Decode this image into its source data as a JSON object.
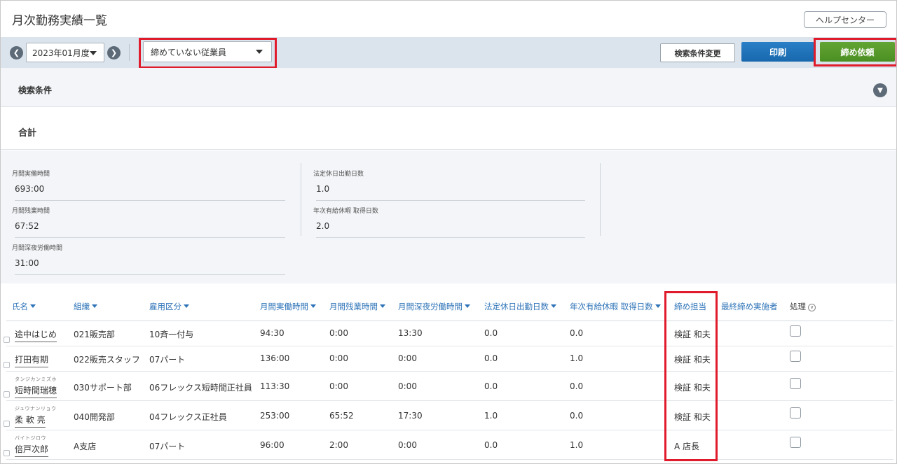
{
  "header": {
    "title": "月次勤務実績一覧",
    "help_label": "ヘルプセンター"
  },
  "toolbar": {
    "month": "2023年01月度",
    "filter": "締めていない従業員",
    "search_change_label": "検索条件変更",
    "print_label": "印刷",
    "close_request_label": "締め依頼"
  },
  "search": {
    "title": "検索条件"
  },
  "totals": {
    "title": "合計",
    "items": [
      {
        "label": "月間実働時間",
        "value": "693:00"
      },
      {
        "label": "月間残業時間",
        "value": "67:52"
      },
      {
        "label": "月間深夜労働時間",
        "value": "31:00"
      },
      {
        "label": "法定休日出勤日数",
        "value": "1.0"
      },
      {
        "label": "年次有給休暇 取得日数",
        "value": "2.0"
      }
    ]
  },
  "table": {
    "columns": [
      "氏名",
      "組織",
      "雇用区分",
      "月間実働時間",
      "月間残業時間",
      "月間深夜労働時間",
      "法定休日出勤日数",
      "年次有給休暇 取得日数",
      "締め担当",
      "最終締め実施者",
      "処理"
    ],
    "rows": [
      {
        "kana": "",
        "name": "途中はじめ",
        "org": "021販売部",
        "type": "10斉一付与",
        "work": "94:30",
        "overtime": "0:00",
        "night": "13:30",
        "holiday": "0.0",
        "paid": "0.0",
        "closer": "検証 和夫",
        "last": ""
      },
      {
        "kana": "",
        "name": "打田有期",
        "org": "022販売スタッフ",
        "type": "07パート",
        "work": "136:00",
        "overtime": "0:00",
        "night": "0:00",
        "holiday": "0.0",
        "paid": "1.0",
        "closer": "検証 和夫",
        "last": ""
      },
      {
        "kana": "タンジカンミズホ",
        "name": "短時間瑞穂",
        "org": "030サポート部",
        "type": "06フレックス短時間正社員",
        "work": "113:30",
        "overtime": "0:00",
        "night": "0:00",
        "holiday": "0.0",
        "paid": "0.0",
        "closer": "検証 和夫",
        "last": ""
      },
      {
        "kana": "ジュウナンリョウ",
        "name": "柔 軟 亮",
        "org": "040開発部",
        "type": "04フレックス正社員",
        "work": "253:00",
        "overtime": "65:52",
        "night": "17:30",
        "holiday": "1.0",
        "paid": "0.0",
        "closer": "検証 和夫",
        "last": ""
      },
      {
        "kana": "バイトジロウ",
        "name": "倍戸次郎",
        "org": "A支店",
        "type": "07パート",
        "work": "96:00",
        "overtime": "2:00",
        "night": "0:00",
        "holiday": "0.0",
        "paid": "1.0",
        "closer": "A 店長",
        "last": ""
      }
    ]
  },
  "colors": {
    "toolbar_bg": "#dbe4ec",
    "print_blue": "#1868ad",
    "close_green": "#4b8f22",
    "highlight_red": "#e01b2b",
    "header_link": "#2f74b8"
  }
}
